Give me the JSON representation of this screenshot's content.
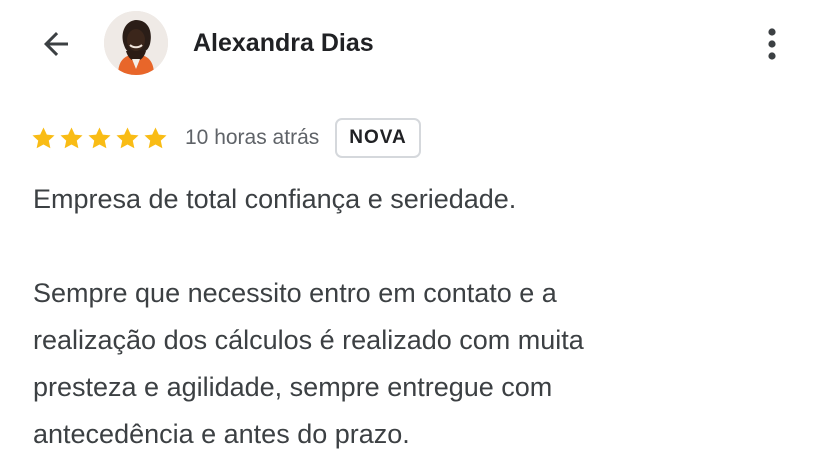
{
  "header": {
    "back_icon": "arrow-back-icon",
    "avatar_icon": "avatar-photo",
    "reviewer_name": "Alexandra Dias",
    "more_icon": "more-vert-icon"
  },
  "review": {
    "rating": 5,
    "rating_max": 5,
    "star_color": "#f9bc15",
    "timestamp": "10 horas atrás",
    "badge": "NOVA",
    "paragraph_1": "Empresa de total confiança e seriedade.",
    "paragraph_2_lines": [
      "Sempre que necessito entro em contato e a",
      "realização dos cálculos é realizado com muita",
      "presteza e agilidade, sempre entregue com",
      "antecedência e antes do prazo."
    ]
  }
}
